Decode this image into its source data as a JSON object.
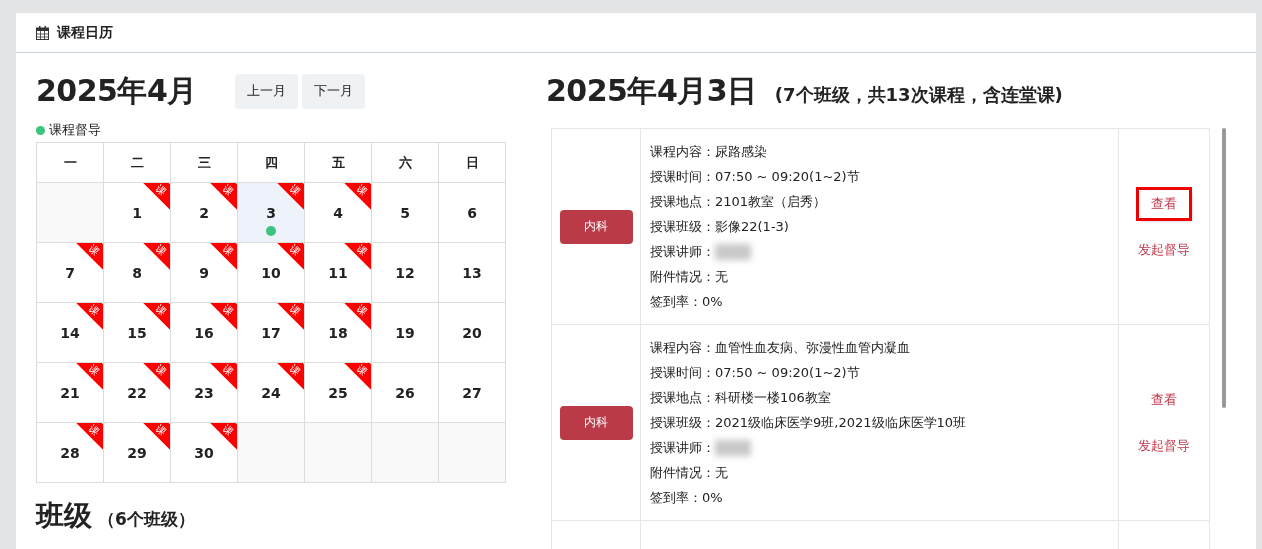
{
  "header": {
    "title": "课程日历"
  },
  "calendar": {
    "month_title": "2025年4月",
    "buttons": [
      "上一月",
      "下一月"
    ],
    "legend": {
      "label": "课程督导",
      "color": "#3ac47d"
    },
    "weekdays": [
      "一",
      "二",
      "三",
      "四",
      "五",
      "六",
      "日"
    ],
    "weeks": [
      [
        {
          "kind": "blank"
        },
        {
          "kind": "day",
          "day": "1",
          "ribbon": "课",
          "selected": false,
          "supervised": false
        },
        {
          "kind": "day",
          "day": "2",
          "ribbon": "课",
          "selected": false,
          "supervised": false
        },
        {
          "kind": "day",
          "day": "3",
          "ribbon": "课",
          "selected": true,
          "supervised": true
        },
        {
          "kind": "day",
          "day": "4",
          "ribbon": "课",
          "selected": false,
          "supervised": false
        },
        {
          "kind": "day",
          "day": "5",
          "selected": false,
          "supervised": false
        },
        {
          "kind": "day",
          "day": "6",
          "selected": false,
          "supervised": false
        }
      ],
      [
        {
          "kind": "day",
          "day": "7",
          "ribbon": "课",
          "selected": false,
          "supervised": false
        },
        {
          "kind": "day",
          "day": "8",
          "ribbon": "课",
          "selected": false,
          "supervised": false
        },
        {
          "kind": "day",
          "day": "9",
          "ribbon": "课",
          "selected": false,
          "supervised": false
        },
        {
          "kind": "day",
          "day": "10",
          "ribbon": "课",
          "selected": false,
          "supervised": false
        },
        {
          "kind": "day",
          "day": "11",
          "ribbon": "课",
          "selected": false,
          "supervised": false
        },
        {
          "kind": "day",
          "day": "12",
          "selected": false,
          "supervised": false
        },
        {
          "kind": "day",
          "day": "13",
          "selected": false,
          "supervised": false
        }
      ],
      [
        {
          "kind": "day",
          "day": "14",
          "ribbon": "课",
          "selected": false,
          "supervised": false
        },
        {
          "kind": "day",
          "day": "15",
          "ribbon": "课",
          "selected": false,
          "supervised": false
        },
        {
          "kind": "day",
          "day": "16",
          "ribbon": "课",
          "selected": false,
          "supervised": false
        },
        {
          "kind": "day",
          "day": "17",
          "ribbon": "课",
          "selected": false,
          "supervised": false
        },
        {
          "kind": "day",
          "day": "18",
          "ribbon": "课",
          "selected": false,
          "supervised": false
        },
        {
          "kind": "day",
          "day": "19",
          "selected": false,
          "supervised": false
        },
        {
          "kind": "day",
          "day": "20",
          "selected": false,
          "supervised": false
        }
      ],
      [
        {
          "kind": "day",
          "day": "21",
          "ribbon": "课",
          "selected": false,
          "supervised": false
        },
        {
          "kind": "day",
          "day": "22",
          "ribbon": "课",
          "selected": false,
          "supervised": false
        },
        {
          "kind": "day",
          "day": "23",
          "ribbon": "课",
          "selected": false,
          "supervised": false
        },
        {
          "kind": "day",
          "day": "24",
          "ribbon": "课",
          "selected": false,
          "supervised": false
        },
        {
          "kind": "day",
          "day": "25",
          "ribbon": "课",
          "selected": false,
          "supervised": false
        },
        {
          "kind": "day",
          "day": "26",
          "selected": false,
          "supervised": false
        },
        {
          "kind": "day",
          "day": "27",
          "selected": false,
          "supervised": false
        }
      ],
      [
        {
          "kind": "day",
          "day": "28",
          "ribbon": "课",
          "selected": false,
          "supervised": false
        },
        {
          "kind": "day",
          "day": "29",
          "ribbon": "课",
          "selected": false,
          "supervised": false
        },
        {
          "kind": "day",
          "day": "30",
          "ribbon": "课",
          "selected": false,
          "supervised": false
        },
        {
          "kind": "blank"
        },
        {
          "kind": "blank"
        },
        {
          "kind": "blank"
        },
        {
          "kind": "blank"
        }
      ]
    ]
  },
  "classes": {
    "title": "班级",
    "count": "（6个班级）"
  },
  "schedule": {
    "date_title": "2025年4月3日",
    "summary": "(7个班级，共13次课程，含连堂课)",
    "rows": [
      {
        "tag": "内科",
        "fields": [
          {
            "kind": "text",
            "text": "课程内容：尿路感染"
          },
          {
            "kind": "text",
            "text": "授课时间：07:50 ~ 09:20(1~2)节"
          },
          {
            "kind": "text",
            "text": "授课地点：2101教室（启秀）"
          },
          {
            "kind": "text",
            "text": "授课班级：影像22(1-3)"
          },
          {
            "kind": "redacted",
            "text": "授课讲师："
          },
          {
            "kind": "text",
            "text": "附件情况：无"
          },
          {
            "kind": "text",
            "text": "签到率：0%"
          }
        ],
        "actions": [
          {
            "label": "查看",
            "focused": true
          },
          {
            "label": "发起督导",
            "focused": false
          }
        ]
      },
      {
        "tag": "内科",
        "fields": [
          {
            "kind": "text",
            "text": "课程内容：血管性血友病、弥漫性血管内凝血"
          },
          {
            "kind": "text",
            "text": "授课时间：07:50 ~ 09:20(1~2)节"
          },
          {
            "kind": "text",
            "text": "授课地点：科研楼一楼106教室"
          },
          {
            "kind": "text",
            "text": "授课班级：2021级临床医学9班,2021级临床医学10班"
          },
          {
            "kind": "redacted",
            "text": "授课讲师："
          },
          {
            "kind": "text",
            "text": "附件情况：无"
          },
          {
            "kind": "text",
            "text": "签到率：0%"
          }
        ],
        "actions": [
          {
            "label": "查看",
            "focused": false
          },
          {
            "label": "发起督导",
            "focused": false
          }
        ]
      }
    ]
  }
}
